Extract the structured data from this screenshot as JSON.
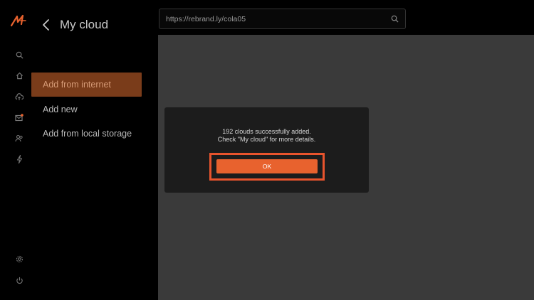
{
  "colors": {
    "accent": "#e8622e",
    "highlight_frame": "#e8542d",
    "active_item_bg": "#7a3c1a"
  },
  "rail": {
    "top_icons": [
      "search-icon",
      "home-icon",
      "cloud-upload-icon",
      "mail-icon",
      "users-icon",
      "bolt-icon"
    ],
    "bottom_icons": [
      "settings-icon",
      "power-icon"
    ]
  },
  "panel": {
    "title": "My cloud",
    "items": [
      {
        "label": "Add from internet",
        "active": true
      },
      {
        "label": "Add new",
        "active": false
      },
      {
        "label": "Add from local storage",
        "active": false
      }
    ]
  },
  "search": {
    "value": "https://rebrand.ly/cola05"
  },
  "dialog": {
    "line1": "192 clouds successfully added.",
    "line2": "Check \"My cloud\" for more details.",
    "ok_label": "OK"
  }
}
